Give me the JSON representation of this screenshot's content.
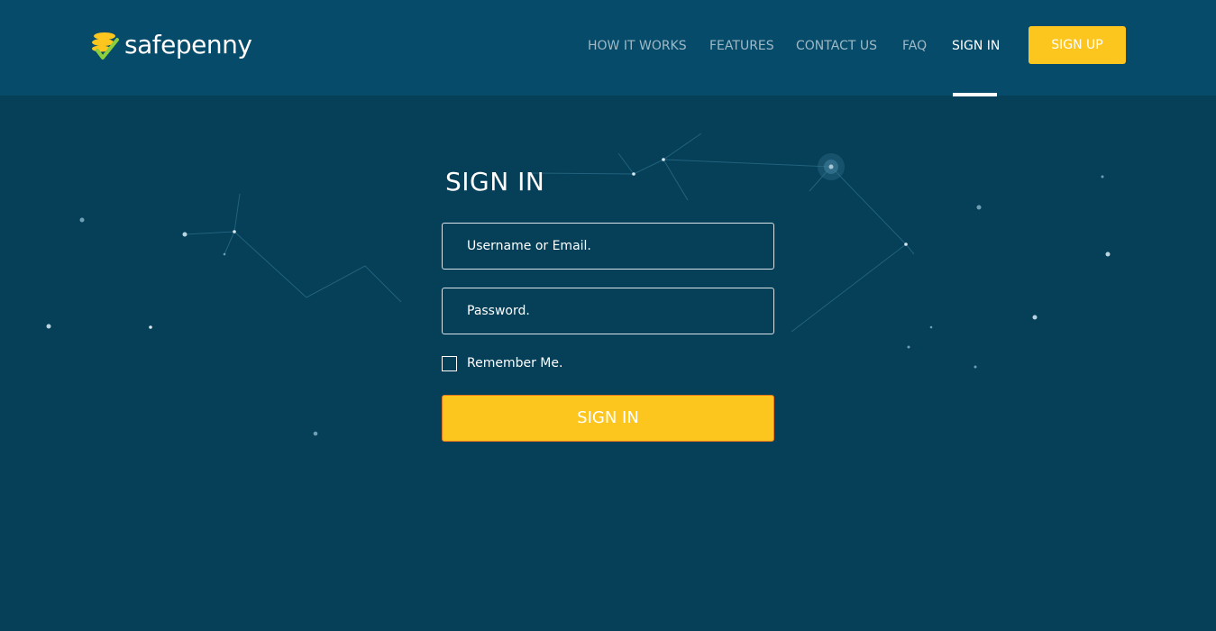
{
  "brand": {
    "name": "safepenny",
    "accent": "#fdc61f",
    "check_color": "#8ccf3c",
    "header_bg": "#064b6a",
    "page_bg": "#053f58"
  },
  "nav": {
    "items": [
      {
        "label": "HOW IT WORKS",
        "active": false
      },
      {
        "label": "FEATURES",
        "active": false
      },
      {
        "label": "CONTACT US",
        "active": false
      },
      {
        "label": "FAQ",
        "active": false
      },
      {
        "label": "SIGN IN",
        "active": true
      }
    ],
    "signup_label": "SIGN UP"
  },
  "form": {
    "title": "SIGN IN",
    "username_placeholder": "Username or Email.",
    "username_value": "",
    "password_placeholder": "Password.",
    "password_value": "",
    "remember_label": "Remember Me.",
    "remember_checked": false,
    "submit_label": "SIGN IN"
  }
}
